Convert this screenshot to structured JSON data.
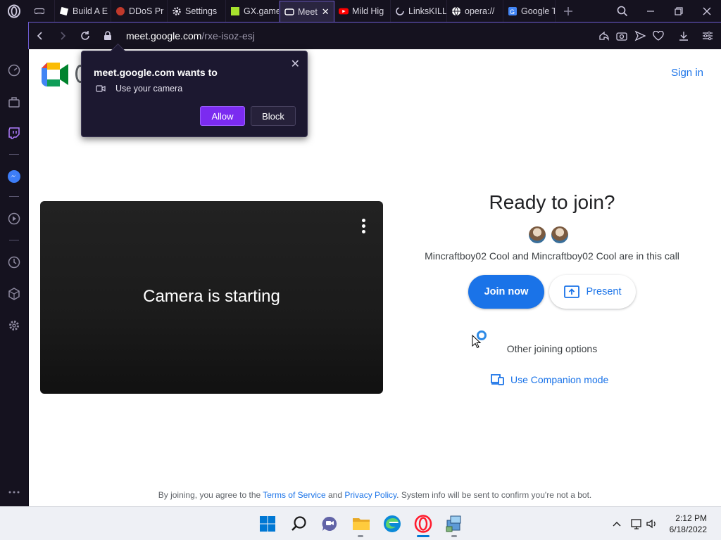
{
  "browser": {
    "tabs": [
      {
        "label": "",
        "icon": "controller-icon"
      },
      {
        "label": "Build A E",
        "icon": "roblox-icon"
      },
      {
        "label": "DDoS Pr",
        "icon": "ddos-icon"
      },
      {
        "label": "Settings",
        "icon": "gear-icon"
      },
      {
        "label": "GX.game",
        "icon": "gx-icon"
      },
      {
        "label": "Meet",
        "icon": "meet-icon",
        "active": true
      },
      {
        "label": "Mild Hig",
        "icon": "youtube-icon"
      },
      {
        "label": "LinksKILL",
        "icon": "loading-icon"
      },
      {
        "label": "opera://",
        "icon": "globe-icon"
      },
      {
        "label": "Google T",
        "icon": "google-translate-icon"
      }
    ],
    "url_domain": "meet.google.com",
    "url_path": "/rxe-isoz-esj"
  },
  "permission_popup": {
    "title": "meet.google.com wants to",
    "permission": "Use your camera",
    "allow_label": "Allow",
    "block_label": "Block"
  },
  "meet": {
    "sign_in": "Sign in",
    "camera_status": "Camera is starting",
    "ready_title": "Ready to join?",
    "in_call_text": "Mincraftboy02 Cool and Mincraftboy02 Cool are in this call",
    "join_label": "Join now",
    "present_label": "Present",
    "other_options": "Other joining options",
    "companion_label": "Use Companion mode",
    "footer": {
      "prefix": "By joining, you agree to the ",
      "terms": "Terms of Service",
      "and": " and ",
      "privacy": "Privacy Policy",
      "suffix": ". System info will be sent to confirm you're not a bot."
    }
  },
  "taskbar": {
    "time": "2:12 PM",
    "date": "6/18/2022"
  },
  "colors": {
    "accent": "#1a73e8",
    "opera_purple": "#7b2bf0",
    "browser_bg": "#15121f"
  }
}
